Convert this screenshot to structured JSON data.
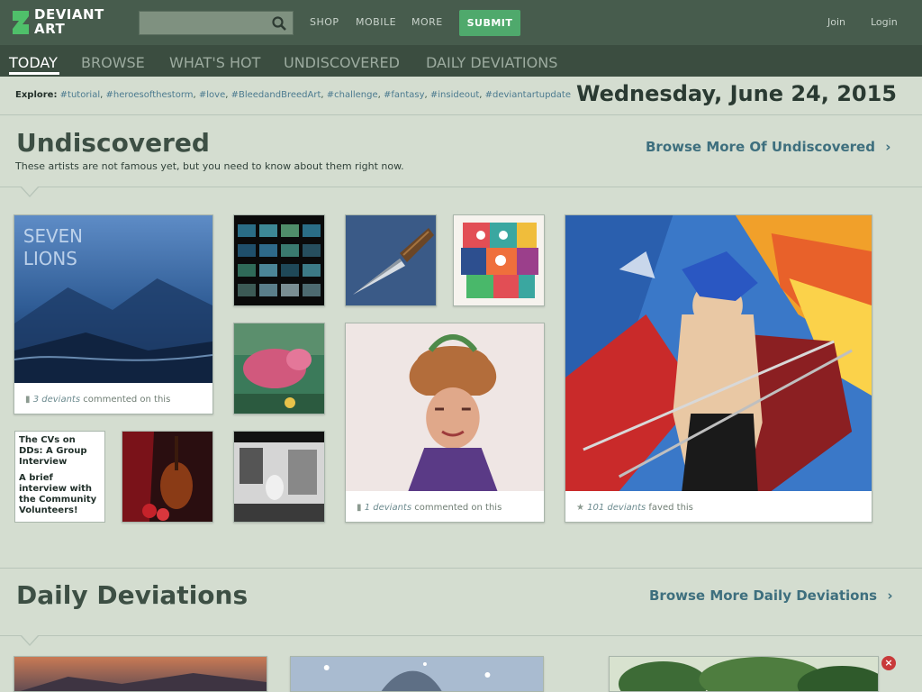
{
  "header": {
    "logo_line1": "DEVIANT",
    "logo_line2": "ART",
    "search_placeholder": "",
    "nav": [
      "SHOP",
      "MOBILE",
      "MORE"
    ],
    "submit_label": "SUBMIT",
    "join_label": "Join",
    "login_label": "Login"
  },
  "tabs": [
    "TODAY",
    "BROWSE",
    "WHAT'S HOT",
    "UNDISCOVERED",
    "DAILY DEVIATIONS"
  ],
  "explore": {
    "label": "Explore:",
    "tags": [
      "#tutorial",
      "#heroesofthestorm",
      "#love",
      "#BleedandBreedArt",
      "#challenge",
      "#fantasy",
      "#insideout",
      "#deviantartupdate"
    ]
  },
  "date": "Wednesday, June 24, 2015",
  "undiscovered": {
    "title": "Undiscovered",
    "subtitle": "These artists are not famous yet, but you need to know about them right now.",
    "browse_more": "Browse More Of Undiscovered",
    "card1_caption_count": "3 deviants",
    "card1_caption_rest": " commented on this",
    "card2_caption_count": "1 deviants",
    "card2_caption_rest": " commented on this",
    "card3_caption_count": "101 deviants",
    "card3_caption_rest": " faved this",
    "poster_text_1": "SEVEN",
    "poster_text_2": "LIONS",
    "article_title": "The CVs on DDs: A Group Interview",
    "article_body": "A brief interview with the Community Volunteers!"
  },
  "daily": {
    "title": "Daily Deviations",
    "browse_more": "Browse More Daily Deviations"
  },
  "colors": {
    "topbar": "#475c4d",
    "subnav": "#3b4d40",
    "page_bg": "#d4ddd0",
    "accent_green": "#4fa96c",
    "link_blue": "#3e6f7e"
  }
}
